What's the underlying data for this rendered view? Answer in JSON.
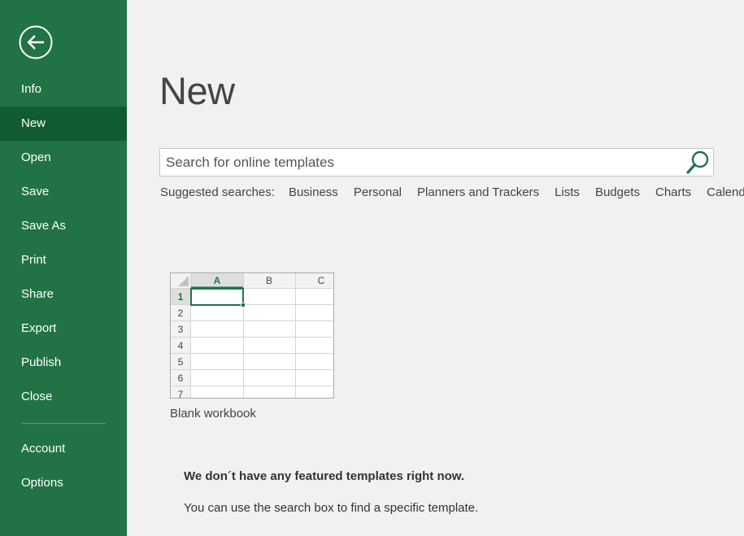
{
  "sidebar": {
    "back_label": "Back",
    "items": [
      {
        "label": "Info",
        "active": false
      },
      {
        "label": "New",
        "active": true
      },
      {
        "label": "Open",
        "active": false
      },
      {
        "label": "Save",
        "active": false
      },
      {
        "label": "Save As",
        "active": false
      },
      {
        "label": "Print",
        "active": false
      },
      {
        "label": "Share",
        "active": false
      },
      {
        "label": "Export",
        "active": false
      },
      {
        "label": "Publish",
        "active": false
      },
      {
        "label": "Close",
        "active": false
      }
    ],
    "bottom_items": [
      {
        "label": "Account"
      },
      {
        "label": "Options"
      }
    ]
  },
  "main": {
    "title": "New",
    "search": {
      "placeholder": "Search for online templates",
      "value": ""
    },
    "suggested": {
      "label": "Suggested searches:",
      "links": [
        "Business",
        "Personal",
        "Planners and Trackers",
        "Lists",
        "Budgets",
        "Charts",
        "Calendars"
      ]
    },
    "templates": [
      {
        "label": "Blank workbook",
        "columns": [
          "A",
          "B",
          "C"
        ],
        "rows": [
          "1",
          "2",
          "3",
          "4",
          "5",
          "6",
          "7"
        ]
      }
    ],
    "message": {
      "heading": "We don´t have any featured templates right now.",
      "body": "You can use the search box to find a specific template."
    }
  },
  "colors": {
    "sidebar": "#217346",
    "sidebar_active": "#0e5c30",
    "background": "#f1f1f1",
    "accent": "#217346"
  }
}
